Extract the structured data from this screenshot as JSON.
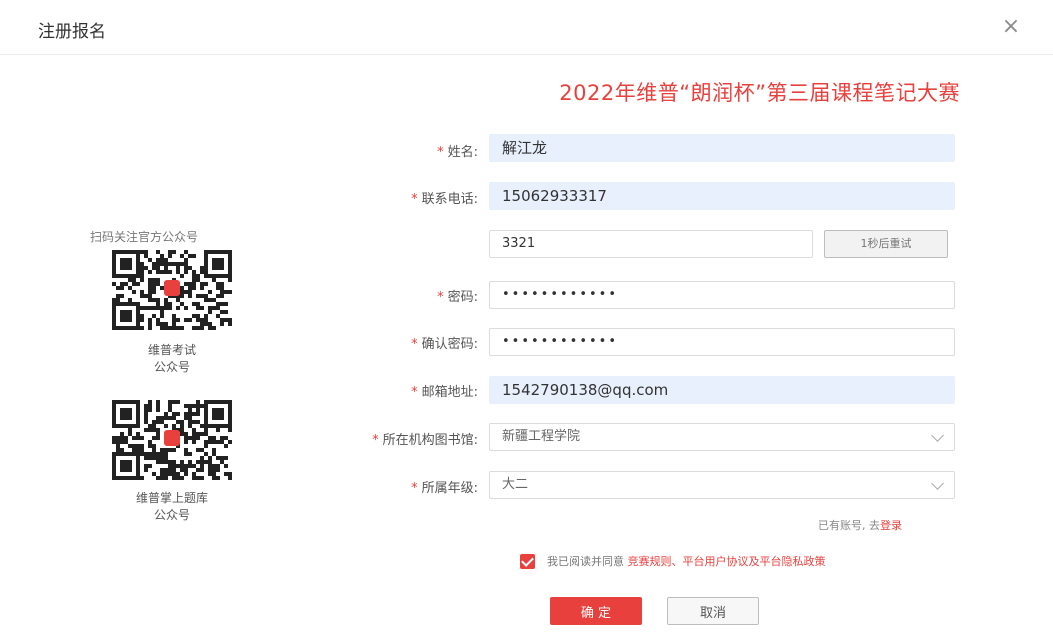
{
  "dialog": {
    "title": "注册报名",
    "close_icon": "close-icon"
  },
  "contest_title": "2022年维普“朗润杯”第三届课程笔记大赛",
  "sidebar": {
    "heading": "扫码关注官方公众号",
    "qr1": {
      "caption_line1": "维普考试",
      "caption_line2": "公众号"
    },
    "qr2": {
      "caption_line1": "维普掌上题库",
      "caption_line2": "公众号"
    }
  },
  "form": {
    "required_mark": "*",
    "name": {
      "label": "姓名:",
      "value": "解江龙"
    },
    "phone": {
      "label": "联系电话:",
      "value": "15062933317"
    },
    "sms": {
      "value": "3321",
      "button_label": "1秒后重试"
    },
    "password": {
      "label": "密码:",
      "value": "••••••••••••"
    },
    "confirm_password": {
      "label": "确认密码:",
      "value": "••••••••••••"
    },
    "email": {
      "label": "邮箱地址:",
      "value": "1542790138@qq.com"
    },
    "institution": {
      "label": "所在机构图书馆:",
      "value": "新疆工程学院"
    },
    "grade": {
      "label": "所属年级:",
      "value": "大二"
    }
  },
  "login_hint": {
    "text": "已有账号, 去",
    "link": "登录"
  },
  "agreement": {
    "text": "我已阅读并同意",
    "link": "竞赛规则、平台用户协议及平台隐私政策"
  },
  "buttons": {
    "confirm": "确 定",
    "cancel": "取消"
  },
  "colors": {
    "accent": "#e8413d",
    "filled_bg": "#e8f0fe"
  }
}
